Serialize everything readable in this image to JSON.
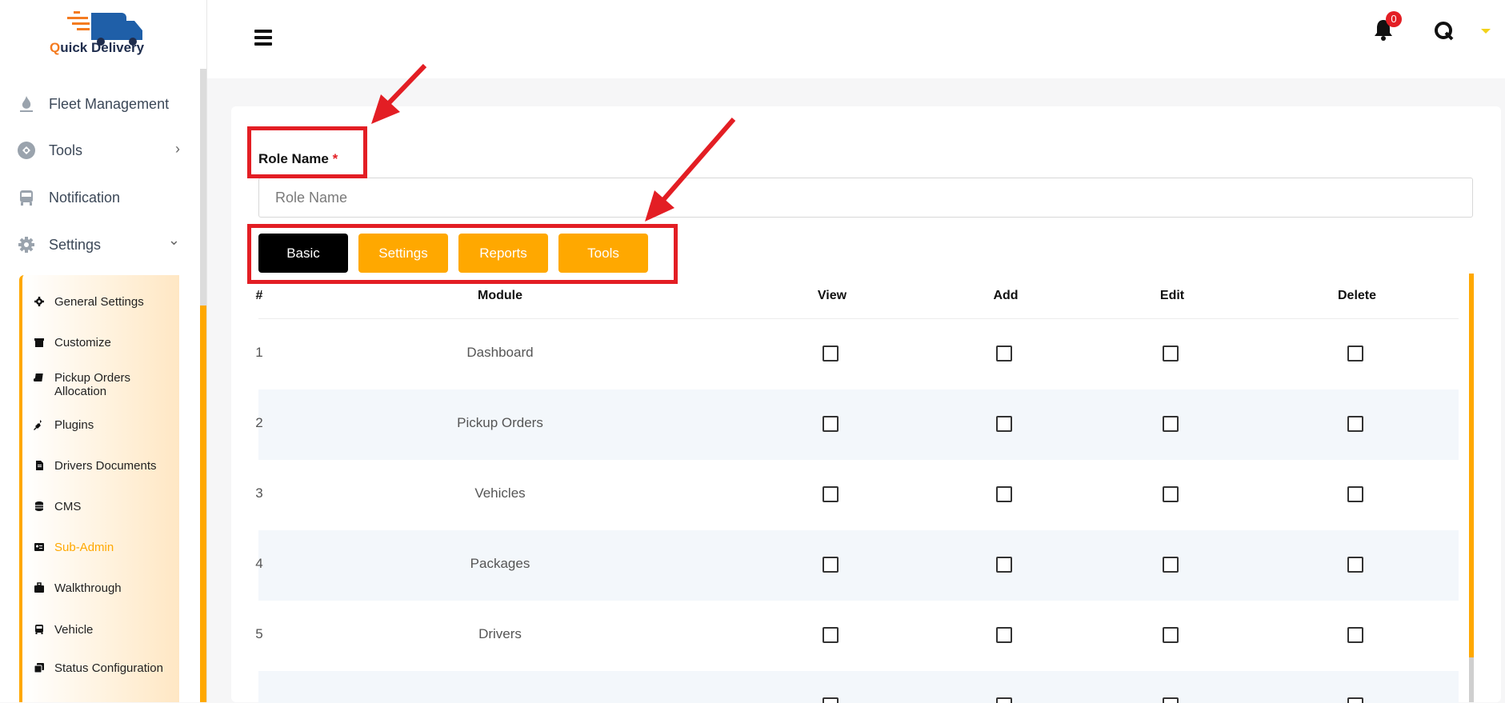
{
  "brand": {
    "q": "Q",
    "rest": "uick Delivery"
  },
  "sidebar": {
    "items": [
      {
        "label": "Fleet Management",
        "icon": "flame-icon"
      },
      {
        "label": "Tools",
        "icon": "tools-icon"
      },
      {
        "label": "Notification",
        "icon": "bus-icon"
      },
      {
        "label": "Settings",
        "icon": "gear-icon"
      }
    ],
    "submenu": [
      {
        "label": "General Settings",
        "icon": "gear-icon"
      },
      {
        "label": "Customize",
        "icon": "archive-icon"
      },
      {
        "label": "Pickup Orders Allocation",
        "icon": "book-icon"
      },
      {
        "label": "Plugins",
        "icon": "plug-icon"
      },
      {
        "label": "Drivers Documents",
        "icon": "file-icon"
      },
      {
        "label": "CMS",
        "icon": "database-icon"
      },
      {
        "label": "Sub-Admin",
        "icon": "id-card-icon",
        "active": true
      },
      {
        "label": "Walkthrough",
        "icon": "briefcase-icon"
      },
      {
        "label": "Vehicle",
        "icon": "bus-icon"
      },
      {
        "label": "Status Configuration",
        "icon": "copy-icon"
      }
    ],
    "active_color": "#ffa800"
  },
  "header": {
    "notification_count": "0"
  },
  "form": {
    "role_label": "Role Name",
    "required_mark": "*",
    "role_placeholder": "Role Name",
    "role_value": ""
  },
  "tabs": [
    "Basic",
    "Settings",
    "Reports",
    "Tools"
  ],
  "table": {
    "headers": [
      "#",
      "Module",
      "View",
      "Add",
      "Edit",
      "Delete"
    ],
    "rows": [
      {
        "num": "1",
        "module": "Dashboard"
      },
      {
        "num": "2",
        "module": "Pickup Orders"
      },
      {
        "num": "3",
        "module": "Vehicles"
      },
      {
        "num": "4",
        "module": "Packages"
      },
      {
        "num": "5",
        "module": "Drivers"
      }
    ]
  },
  "colors": {
    "accent": "#ffa800",
    "highlight": "#e31e24",
    "active_tab": "#000000"
  }
}
